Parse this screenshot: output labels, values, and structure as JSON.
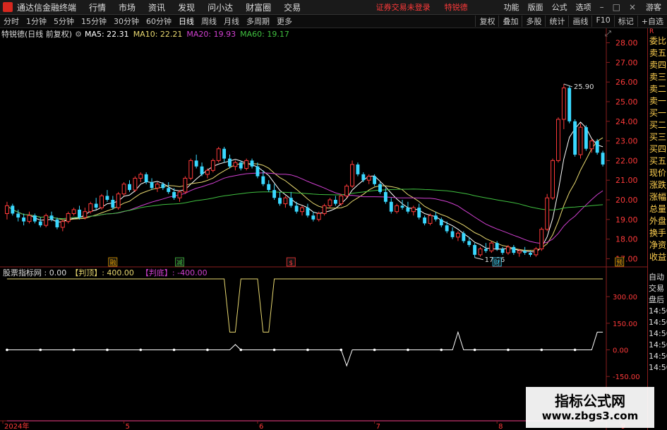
{
  "menubar": {
    "app_title": "通达信金融终端",
    "items": [
      "行情",
      "市场",
      "资讯",
      "发现",
      "问小达",
      "财富圈",
      "交易"
    ],
    "warning": "证券交易未登录",
    "stock_tag": "特锐德",
    "right_items": [
      "功能",
      "版面",
      "公式",
      "选项"
    ],
    "guest": "游客"
  },
  "periodbar": {
    "periods": [
      "分时",
      "1分钟",
      "5分钟",
      "15分钟",
      "30分钟",
      "60分钟",
      "日线",
      "周线",
      "月线",
      "多周期",
      "更多"
    ],
    "active": "日线",
    "tools": [
      "复权",
      "叠加",
      "多股",
      "统计",
      "画线",
      "F10",
      "标记",
      "+自选"
    ]
  },
  "info": {
    "stock": "特锐德(日线 前复权)",
    "ma5": "MA5: 22.31",
    "ma10": "MA10: 22.21",
    "ma20": "MA20: 19.93",
    "ma60": "MA60: 19.17"
  },
  "sub_info": {
    "name": "股票指标网 : 0.00",
    "top": "【判顶】: 400.00",
    "bottom": "【判底】: -400.00"
  },
  "sidebar": [
    "委比",
    "卖五",
    "卖四",
    "卖三",
    "卖二",
    "卖一",
    "买一",
    "买二",
    "买三",
    "买四",
    "买五",
    "现价",
    "涨跌",
    "涨幅",
    "总量",
    "外盘",
    "换手",
    "净资",
    "收益"
  ],
  "sub_sidebar": [
    "自动",
    "交易",
    "盘后",
    "14:50",
    "14:50",
    "14:50",
    "14:50",
    "14:50",
    "14:50"
  ],
  "watermark": {
    "title": "指标公式网",
    "url": "www.zbgs3.com"
  },
  "colors": {
    "up": "#ff3a3a",
    "down": "#3ad8ff",
    "ma5": "#ffffff",
    "ma10": "#e8d870",
    "ma20": "#d040d0",
    "ma60": "#40c040",
    "axis": "#8a1e1e",
    "price_label": "#ff3a3a"
  },
  "icons": [
    "app-logo-icon",
    "minimize-icon",
    "maximize-icon",
    "close-icon",
    "settings-icon",
    "expand-icon"
  ],
  "chart_data": [
    {
      "type": "candlestick",
      "title": "特锐德(日线 前复权)",
      "y_ticks": [
        "28.00",
        "27.00",
        "26.00",
        "25.00",
        "24.00",
        "23.00",
        "22.00",
        "21.00",
        "20.00",
        "19.00",
        "18.00",
        "17.00"
      ],
      "ylim": [
        16.8,
        28.2
      ],
      "x_ticks": [
        "2024年",
        "5",
        "6",
        "7",
        "8",
        "9"
      ],
      "annotations": [
        "25.90",
        "17.06"
      ],
      "event_markers": [
        "融",
        "减",
        "$",
        "财",
        "预"
      ],
      "ohlc": [
        [
          19.3,
          19.9,
          19.0,
          19.7
        ],
        [
          19.7,
          19.8,
          19.2,
          19.3
        ],
        [
          19.3,
          19.5,
          18.9,
          19.1
        ],
        [
          19.1,
          19.3,
          18.7,
          18.9
        ],
        [
          18.9,
          19.4,
          18.8,
          19.2
        ],
        [
          19.2,
          19.3,
          18.8,
          18.9
        ],
        [
          18.9,
          19.1,
          18.6,
          18.7
        ],
        [
          18.7,
          19.3,
          18.6,
          19.2
        ],
        [
          19.2,
          19.4,
          18.9,
          19.0
        ],
        [
          19.0,
          19.1,
          18.5,
          18.6
        ],
        [
          18.6,
          19.0,
          18.4,
          18.9
        ],
        [
          18.9,
          19.4,
          18.8,
          19.3
        ],
        [
          19.3,
          19.6,
          19.2,
          19.5
        ],
        [
          19.5,
          19.7,
          19.0,
          19.1
        ],
        [
          19.1,
          19.6,
          19.0,
          19.4
        ],
        [
          19.4,
          19.9,
          19.3,
          19.8
        ],
        [
          19.8,
          20.1,
          19.5,
          19.6
        ],
        [
          19.6,
          20.3,
          19.5,
          20.2
        ],
        [
          20.2,
          20.5,
          19.9,
          20.0
        ],
        [
          20.0,
          20.2,
          19.5,
          19.6
        ],
        [
          19.6,
          20.4,
          19.5,
          20.3
        ],
        [
          20.3,
          20.9,
          20.2,
          20.8
        ],
        [
          20.8,
          21.0,
          20.4,
          20.5
        ],
        [
          20.5,
          21.2,
          20.4,
          21.1
        ],
        [
          21.1,
          21.4,
          20.9,
          21.3
        ],
        [
          21.3,
          21.4,
          20.8,
          20.9
        ],
        [
          20.9,
          21.1,
          20.5,
          20.6
        ],
        [
          20.6,
          20.9,
          20.4,
          20.8
        ],
        [
          20.8,
          20.9,
          20.5,
          20.6
        ],
        [
          20.6,
          20.9,
          20.3,
          20.4
        ],
        [
          20.4,
          20.6,
          20.0,
          20.1
        ],
        [
          20.1,
          20.5,
          19.9,
          20.4
        ],
        [
          20.4,
          21.2,
          20.3,
          21.1
        ],
        [
          21.1,
          22.1,
          21.0,
          22.0
        ],
        [
          22.0,
          22.3,
          21.6,
          21.7
        ],
        [
          21.7,
          21.9,
          21.2,
          21.3
        ],
        [
          21.3,
          21.6,
          21.1,
          21.5
        ],
        [
          21.5,
          22.1,
          21.4,
          22.0
        ],
        [
          22.0,
          22.7,
          21.9,
          22.6
        ],
        [
          22.6,
          22.7,
          21.9,
          22.1
        ],
        [
          22.1,
          22.3,
          21.6,
          21.7
        ],
        [
          21.7,
          22.0,
          21.5,
          21.9
        ],
        [
          21.9,
          22.0,
          21.5,
          21.6
        ],
        [
          21.6,
          22.1,
          21.5,
          22.0
        ],
        [
          22.0,
          22.1,
          21.6,
          21.7
        ],
        [
          21.7,
          21.9,
          21.1,
          21.2
        ],
        [
          21.2,
          21.5,
          20.7,
          20.8
        ],
        [
          20.8,
          21.0,
          20.4,
          20.5
        ],
        [
          20.5,
          20.8,
          20.0,
          20.1
        ],
        [
          20.1,
          20.4,
          19.7,
          19.8
        ],
        [
          19.8,
          20.2,
          19.6,
          20.1
        ],
        [
          20.1,
          20.4,
          19.6,
          19.7
        ],
        [
          19.7,
          19.9,
          19.3,
          19.4
        ],
        [
          19.4,
          19.7,
          19.2,
          19.6
        ],
        [
          19.6,
          19.8,
          19.1,
          19.2
        ],
        [
          19.2,
          19.4,
          18.9,
          19.0
        ],
        [
          19.0,
          19.4,
          18.9,
          19.3
        ],
        [
          19.3,
          19.8,
          19.2,
          19.7
        ],
        [
          19.7,
          20.1,
          19.6,
          20.0
        ],
        [
          20.0,
          20.2,
          19.7,
          19.8
        ],
        [
          19.8,
          20.3,
          19.7,
          20.2
        ],
        [
          20.2,
          20.8,
          20.1,
          20.7
        ],
        [
          20.7,
          22.0,
          20.6,
          21.8
        ],
        [
          21.8,
          21.9,
          21.2,
          21.3
        ],
        [
          21.3,
          21.4,
          20.9,
          21.0
        ],
        [
          21.0,
          21.3,
          20.8,
          21.2
        ],
        [
          21.2,
          21.3,
          20.7,
          20.8
        ],
        [
          20.8,
          20.9,
          20.3,
          20.4
        ],
        [
          20.4,
          20.6,
          19.8,
          19.9
        ],
        [
          19.9,
          20.1,
          19.3,
          19.4
        ],
        [
          19.4,
          19.8,
          19.3,
          19.7
        ],
        [
          19.7,
          20.0,
          19.5,
          19.6
        ],
        [
          19.6,
          19.9,
          19.3,
          19.4
        ],
        [
          19.4,
          19.7,
          19.2,
          19.6
        ],
        [
          19.6,
          19.8,
          19.0,
          19.1
        ],
        [
          19.1,
          19.2,
          18.7,
          18.8
        ],
        [
          18.8,
          19.3,
          18.7,
          19.2
        ],
        [
          19.2,
          19.4,
          18.9,
          19.0
        ],
        [
          19.0,
          19.1,
          18.6,
          18.7
        ],
        [
          18.7,
          18.9,
          18.3,
          18.4
        ],
        [
          18.4,
          18.6,
          18.0,
          18.1
        ],
        [
          18.1,
          18.4,
          17.9,
          18.3
        ],
        [
          18.3,
          18.4,
          17.8,
          17.9
        ],
        [
          17.9,
          18.1,
          17.6,
          17.7
        ],
        [
          17.7,
          17.8,
          17.06,
          17.2
        ],
        [
          17.2,
          17.6,
          17.1,
          17.5
        ],
        [
          17.5,
          17.8,
          17.3,
          17.4
        ],
        [
          17.4,
          17.9,
          17.3,
          17.8
        ],
        [
          17.8,
          17.9,
          17.4,
          17.5
        ],
        [
          17.5,
          17.6,
          17.2,
          17.3
        ],
        [
          17.3,
          17.7,
          17.2,
          17.6
        ],
        [
          17.6,
          17.7,
          17.2,
          17.3
        ],
        [
          17.3,
          17.5,
          17.1,
          17.4
        ],
        [
          17.4,
          17.6,
          17.2,
          17.3
        ],
        [
          17.3,
          17.4,
          17.1,
          17.2
        ],
        [
          17.2,
          17.6,
          17.1,
          17.5
        ],
        [
          17.5,
          18.6,
          17.4,
          18.5
        ],
        [
          18.5,
          20.3,
          18.4,
          20.1
        ],
        [
          20.1,
          22.1,
          20.0,
          22.0
        ],
        [
          22.0,
          24.2,
          21.9,
          24.1
        ],
        [
          24.1,
          25.9,
          23.6,
          25.7
        ],
        [
          25.7,
          25.8,
          23.9,
          24.0
        ],
        [
          24.0,
          24.1,
          22.2,
          22.3
        ],
        [
          22.3,
          23.9,
          22.1,
          23.7
        ],
        [
          23.7,
          23.8,
          22.5,
          22.6
        ],
        [
          22.6,
          23.1,
          22.4,
          23.0
        ],
        [
          23.0,
          23.1,
          22.3,
          22.4
        ],
        [
          22.4,
          22.5,
          21.7,
          21.8
        ]
      ],
      "series": [
        {
          "name": "MA5",
          "values": [
            22.31
          ]
        },
        {
          "name": "MA10",
          "values": [
            22.21
          ]
        },
        {
          "name": "MA20",
          "values": [
            19.93
          ]
        },
        {
          "name": "MA60",
          "values": [
            19.17
          ]
        }
      ]
    },
    {
      "type": "line",
      "title": "股票指标网",
      "y_ticks": [
        "300.00",
        "150.00",
        "0.00",
        "-150.00"
      ],
      "ylim": [
        -400,
        400
      ],
      "series": [
        {
          "name": "【判顶】",
          "values": [
            300,
            300,
            300,
            300,
            300,
            300,
            300,
            300,
            300,
            300,
            300,
            300,
            300,
            300,
            300,
            300,
            300,
            300,
            300,
            300,
            300,
            300,
            300,
            300,
            300,
            300,
            300,
            300,
            300,
            300,
            300,
            300,
            300,
            300,
            300,
            300,
            300,
            300,
            300,
            300,
            300,
            300,
            300,
            300,
            300,
            300,
            300,
            300,
            300,
            300,
            300,
            300,
            300,
            300,
            300,
            300,
            300,
            300,
            300,
            300,
            300,
            300,
            300,
            300,
            300,
            300,
            300,
            300,
            300,
            300,
            300,
            300,
            300,
            300,
            300,
            300,
            300,
            300,
            300,
            300,
            300,
            300,
            300,
            300,
            300,
            300,
            300,
            300,
            300,
            300,
            300,
            300,
            300,
            300,
            300,
            300,
            300,
            300,
            300,
            300,
            300,
            300,
            300,
            300,
            300,
            300,
            300,
            300,
            300,
            300,
            300,
            300,
            300,
            300
          ]
        },
        {
          "name": "【判底】",
          "values": [
            0
          ]
        },
        {
          "name": "股票指标网",
          "values": [
            0
          ]
        }
      ]
    }
  ]
}
